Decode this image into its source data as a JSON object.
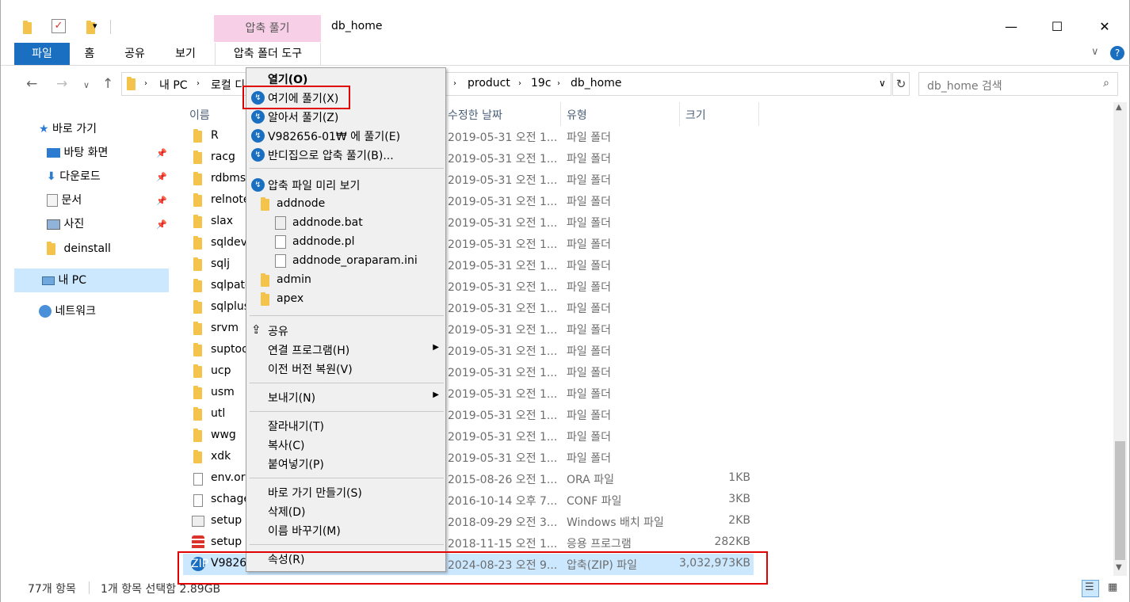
{
  "titlebar": {
    "contextual_tab_header": "압축 풀기",
    "window_title": "db_home",
    "minimize": "—",
    "maximize": "☐",
    "close": "✕"
  },
  "ribbon": {
    "tabs": [
      "파일",
      "홈",
      "공유",
      "보기",
      "압축 폴더 도구"
    ],
    "collapse": "∨",
    "help": "?"
  },
  "address": {
    "segments": [
      "내 PC",
      "로컬 디",
      "product",
      "19c",
      "db_home"
    ],
    "search_placeholder": "db_home 검색"
  },
  "nav": {
    "quick_access": "바로 가기",
    "items": [
      "바탕 화면",
      "다운로드",
      "문서",
      "사진",
      "deinstall"
    ],
    "this_pc": "내 PC",
    "network": "네트워크"
  },
  "columns": {
    "name": "이름",
    "modified": "수정한 날짜",
    "type": "유형",
    "size": "크기"
  },
  "files": [
    {
      "name": "R",
      "date": "2019-05-31 오전 1...",
      "type": "파일 폴더",
      "size": ""
    },
    {
      "name": "racg",
      "date": "2019-05-31 오전 1...",
      "type": "파일 폴더",
      "size": ""
    },
    {
      "name": "rdbms",
      "date": "2019-05-31 오전 1...",
      "type": "파일 폴더",
      "size": ""
    },
    {
      "name": "relnote",
      "date": "2019-05-31 오전 1...",
      "type": "파일 폴더",
      "size": ""
    },
    {
      "name": "slax",
      "date": "2019-05-31 오전 1...",
      "type": "파일 폴더",
      "size": ""
    },
    {
      "name": "sqldev",
      "date": "2019-05-31 오전 1...",
      "type": "파일 폴더",
      "size": ""
    },
    {
      "name": "sqlj",
      "date": "2019-05-31 오전 1...",
      "type": "파일 폴더",
      "size": ""
    },
    {
      "name": "sqlpatc",
      "date": "2019-05-31 오전 1...",
      "type": "파일 폴더",
      "size": ""
    },
    {
      "name": "sqlplus",
      "date": "2019-05-31 오전 1...",
      "type": "파일 폴더",
      "size": ""
    },
    {
      "name": "srvm",
      "date": "2019-05-31 오전 1...",
      "type": "파일 폴더",
      "size": ""
    },
    {
      "name": "suptoo",
      "date": "2019-05-31 오전 1...",
      "type": "파일 폴더",
      "size": ""
    },
    {
      "name": "ucp",
      "date": "2019-05-31 오전 1...",
      "type": "파일 폴더",
      "size": ""
    },
    {
      "name": "usm",
      "date": "2019-05-31 오전 1...",
      "type": "파일 폴더",
      "size": ""
    },
    {
      "name": "utl",
      "date": "2019-05-31 오전 1...",
      "type": "파일 폴더",
      "size": ""
    },
    {
      "name": "wwg",
      "date": "2019-05-31 오전 1...",
      "type": "파일 폴더",
      "size": ""
    },
    {
      "name": "xdk",
      "date": "2019-05-31 오전 1...",
      "type": "파일 폴더",
      "size": ""
    },
    {
      "name": "env.ora",
      "date": "2015-08-26 오전 1...",
      "type": "ORA 파일",
      "size": "1KB"
    },
    {
      "name": "schage",
      "date": "2016-10-14 오후 7...",
      "type": "CONF 파일",
      "size": "3KB"
    },
    {
      "name": "setup",
      "date": "2018-09-29 오전 3...",
      "type": "Windows 배치 파일",
      "size": "2KB"
    },
    {
      "name": "setup",
      "date": "2018-11-15 오전 1...",
      "type": "응용 프로그램",
      "size": "282KB"
    },
    {
      "name": "V98265",
      "date": "2024-08-23 오전 9...",
      "type": "압축(ZIP) 파일",
      "size": "3,032,973KB"
    }
  ],
  "status": {
    "count": "77개 항목",
    "selected": "1개 항목 선택함 2.89GB"
  },
  "menu": {
    "open": "열기(O)",
    "extract_here": "여기에 풀기(X)",
    "extract_smart": "알아서 풀기(Z)",
    "extract_to": "V982656-01₩ 에 풀기(E)",
    "extract_bandizip": "반디집으로 압축 풀기(B)...",
    "preview": "압축 파일 미리 보기",
    "preview_items": [
      "addnode",
      "addnode.bat",
      "addnode.pl",
      "addnode_oraparam.ini",
      "admin",
      "apex"
    ],
    "share": "공유",
    "open_with": "연결 프로그램(H)",
    "restore": "이전 버전 복원(V)",
    "send_to": "보내기(N)",
    "cut": "잘라내기(T)",
    "copy": "복사(C)",
    "paste": "붙여넣기(P)",
    "shortcut": "바로 가기 만들기(S)",
    "delete": "삭제(D)",
    "rename": "이름 바꾸기(M)",
    "properties": "속성(R)"
  },
  "colors": {
    "accent": "#1a6fc1",
    "context_tab": "#f7cfe6",
    "selection": "#cce8ff",
    "highlight_box": "#e00000"
  }
}
